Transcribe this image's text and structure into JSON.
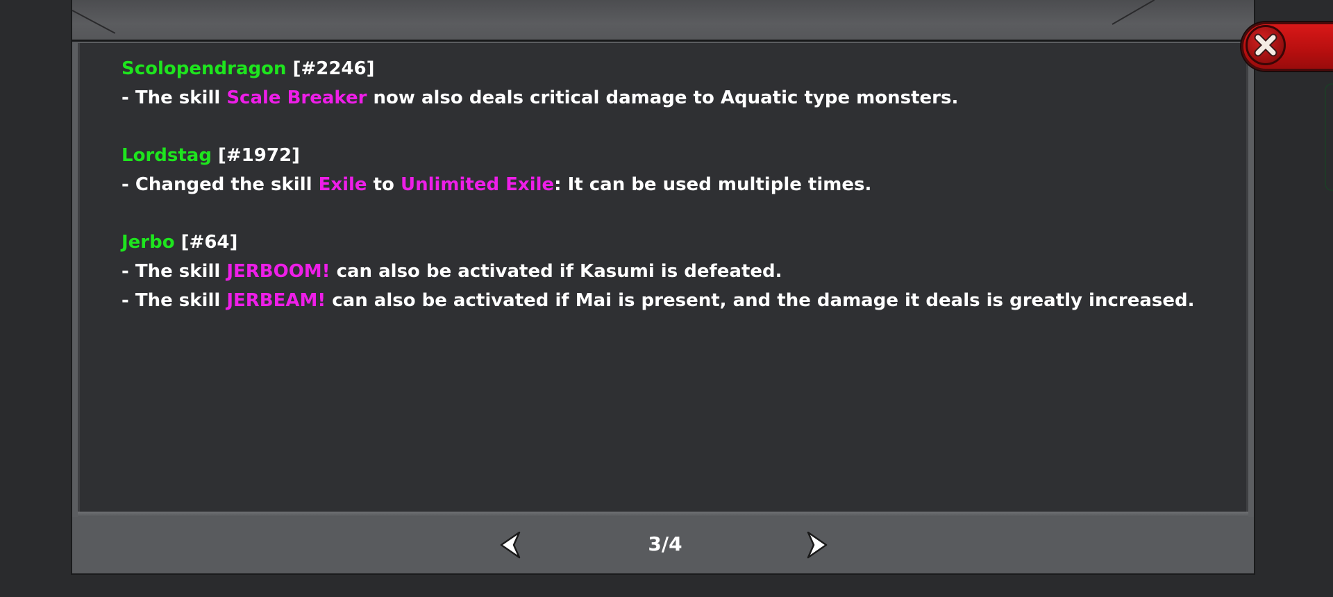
{
  "entries": [
    {
      "name": "Scolopendragon",
      "id": "[#2246]",
      "lines": [
        {
          "pre": "- The skill ",
          "skill": "Scale Breaker",
          "mid": "",
          "skill2": "",
          "post": " now also deals critical damage to Aquatic type monsters."
        }
      ]
    },
    {
      "name": "Lordstag",
      "id": "[#1972]",
      "lines": [
        {
          "pre": "- Changed the skill ",
          "skill": "Exile",
          "mid": " to ",
          "skill2": "Unlimited Exile",
          "post": ": It can be used multiple times."
        }
      ]
    },
    {
      "name": "Jerbo",
      "id": "[#64]",
      "lines": [
        {
          "pre": "- The skill ",
          "skill": "JERBOOM!",
          "mid": "",
          "skill2": "",
          "post": " can also be activated if Kasumi is defeated."
        },
        {
          "pre": "- The skill ",
          "skill": "JERBEAM!",
          "mid": "",
          "skill2": "",
          "post": " can also be activated if Mai is present, and the damage it deals is greatly increased."
        }
      ]
    }
  ],
  "pager": {
    "text": "3/4",
    "prev_icon": "chevron-left-icon",
    "next_icon": "chevron-right-icon"
  },
  "close_button": {
    "icon": "close-icon"
  },
  "colors": {
    "monster_name": "#1ee51e",
    "skill_name": "#ee1ee8",
    "body_text": "#ffffff",
    "close_red": "#d81818"
  }
}
